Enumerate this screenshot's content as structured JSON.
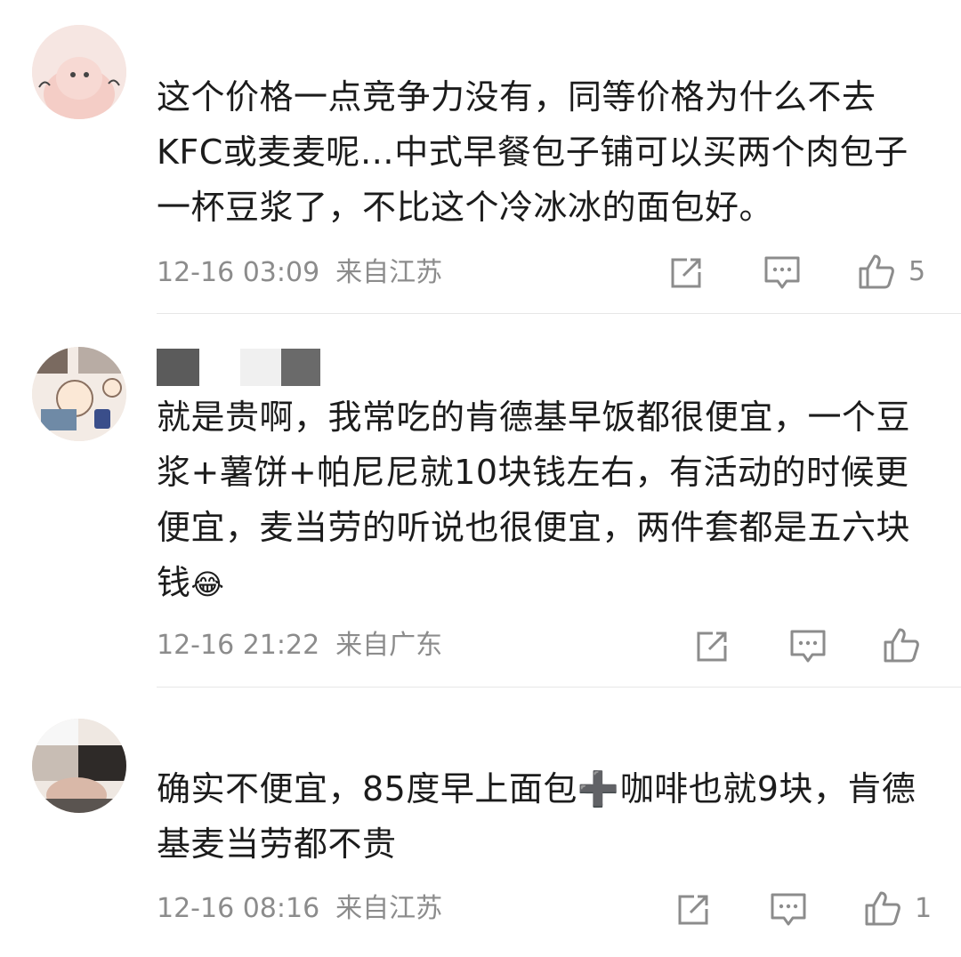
{
  "comments": [
    {
      "text": "这个价格一点竞争力没有，同等价格为什么不去KFC或麦麦呢…中式早餐包子铺可以买两个肉包子一杯豆浆了，不比这个冷冰冰的面包好。",
      "time": "12-16 03:09",
      "location": "来自江苏",
      "likes": "5"
    },
    {
      "text": "就是贵啊，我常吃的肯德基早饭都很便宜，一个豆浆+薯饼+帕尼尼就10块钱左右，有活动的时候更便宜，麦当劳的听说也很便宜，两件套都是五六块钱",
      "emoji": "😂",
      "time": "12-16 21:22",
      "location": "来自广东",
      "likes": ""
    },
    {
      "text_a": "确实不便宜，85度早上面包",
      "plus": "➕",
      "text_b": "咖啡也就9块，肯德基麦当劳都不贵",
      "time": "12-16 08:16",
      "location": "来自江苏",
      "likes": "1"
    }
  ],
  "colors": {
    "text": "#1c1c1c",
    "meta": "#8c8c8c",
    "icon": "#8c8c8c",
    "divider": "#e6e6e6"
  },
  "icons": [
    "share-icon",
    "comment-icon",
    "like-icon"
  ]
}
